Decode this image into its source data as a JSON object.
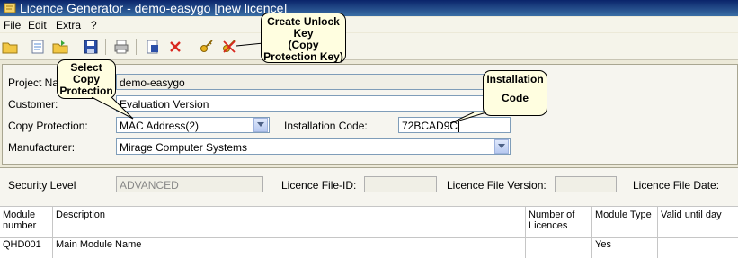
{
  "window": {
    "title": "Licence Generator - demo-easygo [new licence]"
  },
  "menu": {
    "items": [
      "File",
      "Edit",
      "Extra",
      "?"
    ]
  },
  "toolbar": {
    "buttons": [
      "open-folder-icon",
      "new-document-icon",
      "open-file-icon",
      "save-icon",
      "print-icon",
      "preview-icon",
      "delete-icon",
      "create-unlock-key-icon",
      "remove-key-icon"
    ]
  },
  "form": {
    "project_name_label": "Project Name:",
    "project_name_value": "demo-easygo",
    "customer_label": "Customer:",
    "customer_value": "Evaluation Version",
    "copy_protection_label": "Copy Protection:",
    "copy_protection_value": "MAC Address(2)",
    "installation_code_label": "Installation Code:",
    "installation_code_value": "72BCAD9C",
    "manufacturer_label": "Manufacturer:",
    "manufacturer_value": "Mirage Computer Systems"
  },
  "security": {
    "security_level_label": "Security Level",
    "security_level_value": "ADVANCED",
    "licence_file_id_label": "Licence File-ID:",
    "licence_file_version_label": "Licence File Version:",
    "licence_file_date_label": "Licence File Date:"
  },
  "table": {
    "columns": [
      {
        "line1": "Module",
        "line2": "number"
      },
      {
        "line1": "Description",
        "line2": ""
      },
      {
        "line1": "Number of",
        "line2": "Licences"
      },
      {
        "line1": "Module Type",
        "line2": ""
      },
      {
        "line1": "Valid until day",
        "line2": ""
      }
    ],
    "rows": [
      {
        "module_number": "QHD001",
        "description": "Main Module Name",
        "licences": "",
        "module_type": "Yes",
        "valid_until": ""
      }
    ]
  },
  "callouts": {
    "unlock_key": [
      "Create Unlock",
      "Key",
      "(Copy",
      "Protection Key)"
    ],
    "copy_protection": [
      "Select",
      "Copy",
      "Protection"
    ],
    "installation_code": [
      "Installation",
      "",
      "Code"
    ]
  },
  "colors": {
    "titlebar": "#0a246a",
    "callout_bg": "#fffee0",
    "field_border": "#7f9db9"
  }
}
